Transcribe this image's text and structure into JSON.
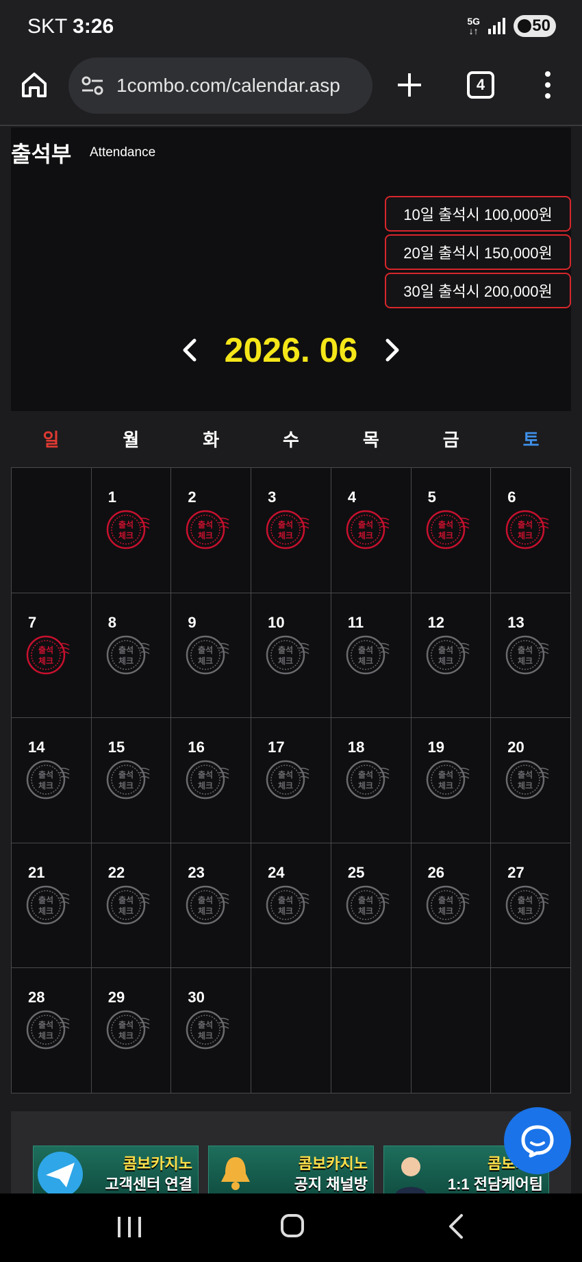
{
  "status": {
    "carrier": "SKT",
    "time": "3:26",
    "network": "5G",
    "battery": "50"
  },
  "browser": {
    "url": "1combo.com/calendar.asp",
    "tab_count": "4"
  },
  "header": {
    "title": "출석부",
    "subtitle": "Attendance"
  },
  "rewards": [
    "10일 출석시 100,000원",
    "20일 출석시 150,000원",
    "30일 출석시 200,000원"
  ],
  "calendar": {
    "month_label": "2026. 06",
    "weekdays": [
      "일",
      "월",
      "화",
      "수",
      "목",
      "금",
      "토"
    ],
    "cells": [
      "",
      "1",
      "2",
      "3",
      "4",
      "5",
      "6",
      "7",
      "8",
      "9",
      "10",
      "11",
      "12",
      "13",
      "14",
      "15",
      "16",
      "17",
      "18",
      "19",
      "20",
      "21",
      "22",
      "23",
      "24",
      "25",
      "26",
      "27",
      "28",
      "29",
      "30",
      "",
      "",
      "",
      ""
    ],
    "checked_days": [
      1,
      2,
      3,
      4,
      5,
      6,
      7
    ],
    "stamp_text_top": "출석",
    "stamp_text_bottom": "체크",
    "stamp_color_checked": "#c8102e",
    "stamp_color_unchecked": "#6a6a6e"
  },
  "banners": [
    {
      "line1": "콤보카지노",
      "line2": "고객센터 연결"
    },
    {
      "line1": "콤보카지노",
      "line2": "공지 채널방"
    },
    {
      "line1": "콤보카지",
      "line2": "1:1 전담케어팀"
    }
  ],
  "colors": {
    "accent_yellow": "#f5e619",
    "sunday": "#e03a32",
    "saturday": "#3f8fe8",
    "reward_border": "#d8262b",
    "chat_button": "#1a73e8"
  }
}
